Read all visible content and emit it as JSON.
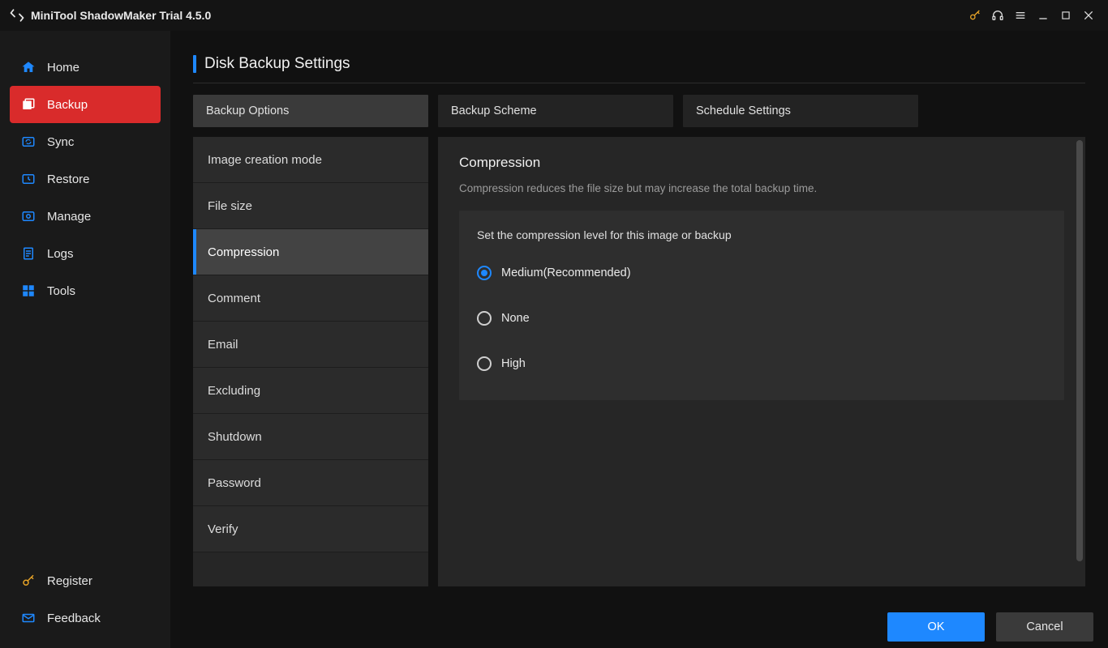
{
  "app": {
    "title": "MiniTool ShadowMaker Trial 4.5.0"
  },
  "sidebar": {
    "items": [
      {
        "label": "Home"
      },
      {
        "label": "Backup"
      },
      {
        "label": "Sync"
      },
      {
        "label": "Restore"
      },
      {
        "label": "Manage"
      },
      {
        "label": "Logs"
      },
      {
        "label": "Tools"
      }
    ],
    "bottom": [
      {
        "label": "Register"
      },
      {
        "label": "Feedback"
      }
    ]
  },
  "page": {
    "title": "Disk Backup Settings"
  },
  "tabs": [
    {
      "label": "Backup Options",
      "active": true
    },
    {
      "label": "Backup Scheme"
    },
    {
      "label": "Schedule Settings"
    }
  ],
  "options": [
    {
      "label": "Image creation mode"
    },
    {
      "label": "File size"
    },
    {
      "label": "Compression",
      "active": true
    },
    {
      "label": "Comment"
    },
    {
      "label": "Email"
    },
    {
      "label": "Excluding"
    },
    {
      "label": "Shutdown"
    },
    {
      "label": "Password"
    },
    {
      "label": "Verify"
    }
  ],
  "panel": {
    "title": "Compression",
    "desc": "Compression reduces the file size but may increase the total backup time.",
    "sub": "Set the compression level for this image or backup",
    "radios": [
      {
        "label": "Medium(Recommended)",
        "selected": true
      },
      {
        "label": "None"
      },
      {
        "label": "High"
      }
    ]
  },
  "footer": {
    "ok": "OK",
    "cancel": "Cancel"
  }
}
